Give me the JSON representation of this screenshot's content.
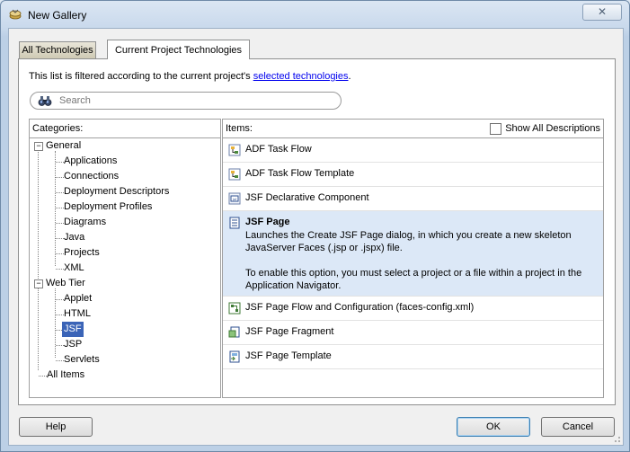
{
  "window": {
    "title": "New Gallery",
    "close_glyph": "✕"
  },
  "tabs": [
    {
      "label": "All Technologies"
    },
    {
      "label": "Current Project Technologies"
    }
  ],
  "info": {
    "prefix": "This list is filtered according to the current project's ",
    "link": "selected technologies",
    "suffix": "."
  },
  "search": {
    "placeholder": "Search",
    "value": ""
  },
  "categories": {
    "header": "Categories:",
    "general": {
      "label": "General",
      "children": [
        "Applications",
        "Connections",
        "Deployment Descriptors",
        "Deployment Profiles",
        "Diagrams",
        "Java",
        "Projects",
        "XML"
      ]
    },
    "web_tier": {
      "label": "Web Tier",
      "children": [
        "Applet",
        "HTML",
        "JSF",
        "JSP",
        "Servlets"
      ]
    },
    "all_items": "All Items",
    "selected": "JSF"
  },
  "items": {
    "header": "Items:",
    "show_all_label": "Show All Descriptions",
    "show_all_checked": false,
    "list": [
      {
        "label": "ADF Task Flow",
        "icon": "task-flow-icon"
      },
      {
        "label": "ADF Task Flow Template",
        "icon": "task-flow-template-icon"
      },
      {
        "label": "JSF Declarative Component",
        "icon": "jsf-component-icon"
      },
      {
        "label": "JSF Page",
        "icon": "jsf-page-icon",
        "desc1": "Launches the Create JSF Page dialog, in which you create a new skeleton JavaServer Faces (.jsp or .jspx) file.",
        "desc2": "To enable this option, you must select a project or a file within a project in the Application Navigator."
      },
      {
        "label": "JSF Page Flow and Configuration (faces-config.xml)",
        "icon": "page-flow-icon"
      },
      {
        "label": "JSF Page Fragment",
        "icon": "page-fragment-icon"
      },
      {
        "label": "JSF Page Template",
        "icon": "page-template-icon"
      }
    ]
  },
  "buttons": {
    "help": "Help",
    "ok": "OK",
    "cancel": "Cancel"
  }
}
